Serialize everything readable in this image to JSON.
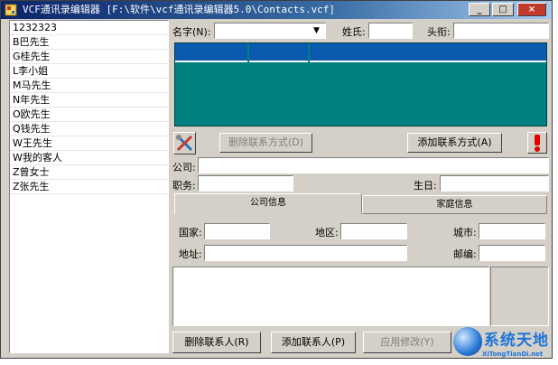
{
  "window": {
    "title": "VCF通讯录编辑器 [F:\\软件\\vcf通讯录编辑器5.0\\Contacts.vcf]",
    "min_glyph": "_",
    "max_glyph": "□",
    "close_glyph": "×"
  },
  "contacts": [
    "1232323",
    "B巴先生",
    "G桂先生",
    "L李小姐",
    "M马先生",
    "N年先生",
    "O欧先生",
    "Q钱先生",
    "W王先生",
    "W我的客人",
    "Z曾女士",
    "Z张先生"
  ],
  "form": {
    "name_label": "名字(N):",
    "name_value": "",
    "surname_label": "姓氏:",
    "surname_value": "",
    "title_label": "头衔:",
    "title_value": "",
    "delete_contact_method": "删除联系方式(D)",
    "add_contact_method": "添加联系方式(A)",
    "company_label": "公司:",
    "company_value": "",
    "position_label": "职务:",
    "position_value": "",
    "birthday_label": "生日:",
    "birthday_value": ""
  },
  "tabs": [
    {
      "label": "公司信息",
      "active": true
    },
    {
      "label": "家庭信息",
      "active": false
    }
  ],
  "address": {
    "country_label": "国家:",
    "region_label": "地区:",
    "city_label": "城市:",
    "street_label": "地址:",
    "zip_label": "邮编:"
  },
  "buttons": {
    "delete_contact": "删除联系人(R)",
    "add_contact": "添加联系人(P)",
    "apply": "应用修改(Y)"
  },
  "watermark": {
    "big": "系统天地",
    "small": "XiTongTianDi.net"
  },
  "colors": {
    "grid_bg": "#008080",
    "grid_header": "#0a5ab0",
    "titlebar": "#0a246a",
    "alert_red": "#e00000"
  }
}
